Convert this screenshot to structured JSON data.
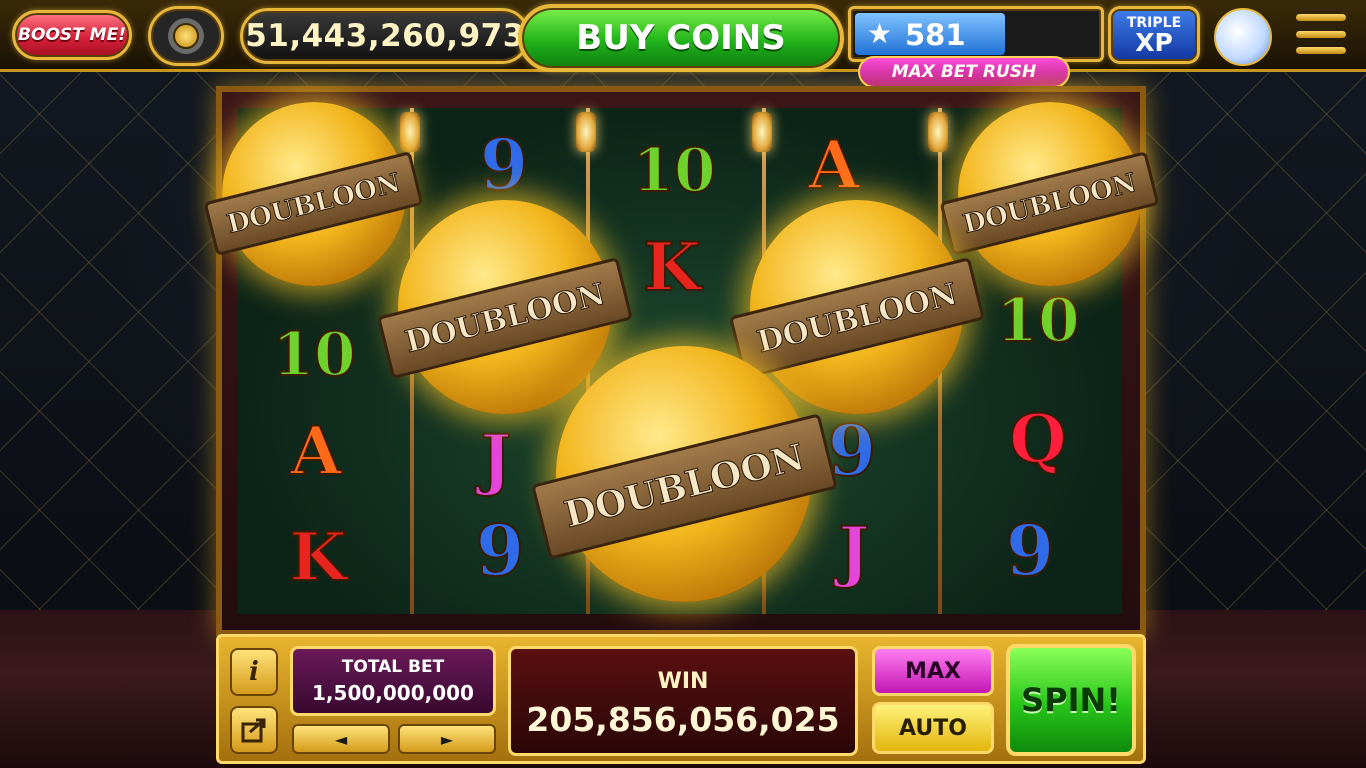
{
  "top_bar": {
    "boost_label": "BOOST ME!",
    "coin_balance": "51,443,260,973",
    "buy_coins_label": "BUY COINS",
    "xp_level": "581",
    "xp_progress": 0.63,
    "promo_label": "MAX BET RUSH",
    "triple_label_1": "TRIPLE",
    "triple_label_2": "XP"
  },
  "reels": {
    "symbols": [
      "9",
      "10",
      "A",
      "K",
      "10",
      "10",
      "A",
      "K",
      "J",
      "9",
      "9",
      "J",
      "Q",
      "9"
    ],
    "doubloon_label": "DOUBLOON"
  },
  "bottom_panel": {
    "info_icon": "i",
    "total_bet_label": "TOTAL BET",
    "total_bet_value": "1,500,000,000",
    "decrease_glyph": "◄",
    "increase_glyph": "►",
    "win_label": "WIN",
    "win_value": "205,856,056,025",
    "max_label": "MAX",
    "auto_label": "AUTO",
    "spin_label": "SPIN!"
  },
  "icons": {
    "star": "star-icon",
    "vault": "vault-icon",
    "share": "share-icon",
    "menu": "hamburger-menu-icon",
    "profile": "cheetah-avatar-icon"
  },
  "colors": {
    "gold": "#e7b83a",
    "buy_green": "#21b41a",
    "boost_red": "#d8203a",
    "xp_blue": "#2272d6",
    "promo_pink": "#ff4fd8"
  }
}
